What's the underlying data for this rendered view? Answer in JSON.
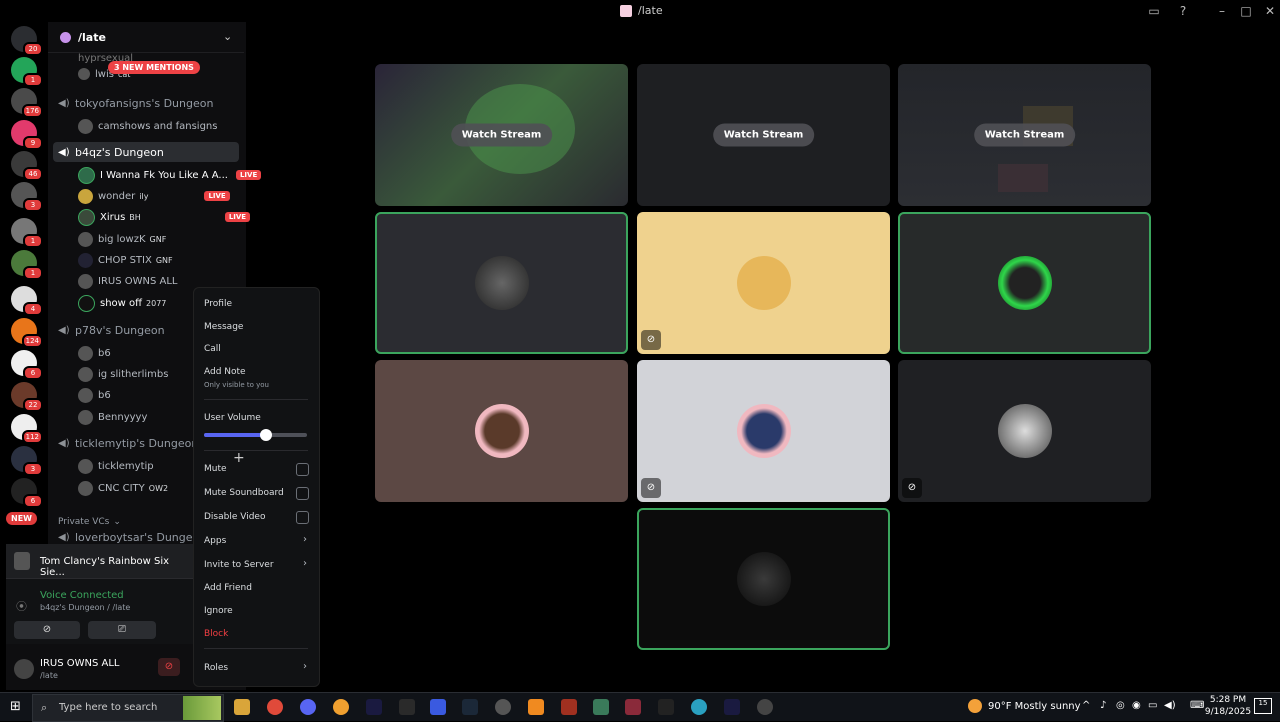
{
  "window": {
    "title": "/late"
  },
  "colors": {
    "live": "#ed4245",
    "speaking": "#3ba55d",
    "voice_connected": "#3ba55d",
    "block": "#f23f43"
  },
  "rail": {
    "badges": [
      "20",
      "1",
      "176",
      "9",
      "46",
      "3",
      "1",
      "1",
      "4",
      "124",
      "6",
      "22",
      "112",
      "3",
      "6",
      "8"
    ],
    "new_label": "NEW"
  },
  "channel": {
    "server_name": "/late",
    "new_mentions": "3 NEW MENTIONS",
    "voice_channels": [
      {
        "name": "tokyofansigns's Dungeon"
      },
      {
        "name": "b4qz's Dungeon"
      },
      {
        "name": "p78v's Dungeon"
      },
      {
        "name": "ticklemytip's Dungeon"
      },
      {
        "name": "loverboytsar's Dungeon"
      }
    ],
    "top_users": [
      "hyprsexual",
      "lwis",
      "cat"
    ],
    "tokyo_users": [
      "camshows and fansigns"
    ],
    "b4qz_users": [
      {
        "name": "I Wanna Fk You Like A A...",
        "live": "LIVE"
      },
      {
        "name": "wonder",
        "tag": "ily",
        "live": "LIVE"
      },
      {
        "name": "Xirus",
        "tag": "BH",
        "live": "LIVE"
      },
      {
        "name": "big lowzK",
        "tag": "GNF"
      },
      {
        "name": "CHOP STIX",
        "tag": "GNF"
      },
      {
        "name": "IRUS OWNS ALL"
      },
      {
        "name": "show off",
        "tag": "2077"
      }
    ],
    "p78v_users": [
      "b6",
      "ig slitherlimbs",
      "b6",
      "Bennyyyy"
    ],
    "tickle_users": [
      {
        "name": "ticklemytip"
      },
      {
        "name": "CNC CITY",
        "tag": "OW2"
      }
    ],
    "private_label": "Private VCs"
  },
  "panel": {
    "activity": "Tom Clancy's Rainbow Six Sie...",
    "voice_status": "Voice Connected",
    "voice_location": "b4qz's Dungeon / /late",
    "username": "IRUS OWNS ALL",
    "user_status": "/late"
  },
  "context_menu": {
    "profile": "Profile",
    "message": "Message",
    "call": "Call",
    "add_note": "Add Note",
    "add_note_sub": "Only visible to you",
    "user_volume": "User Volume",
    "volume_level": 0.6,
    "mute": "Mute",
    "mute_soundboard": "Mute Soundboard",
    "disable_video": "Disable Video",
    "apps": "Apps",
    "invite": "Invite to Server",
    "add_friend": "Add Friend",
    "ignore": "Ignore",
    "block": "Block",
    "roles": "Roles"
  },
  "grid": {
    "watch_label": "Watch Stream"
  },
  "taskbar": {
    "search_placeholder": "Type here to search",
    "weather": "90°F  Mostly sunny",
    "time": "5:28 PM",
    "date": "9/18/2025",
    "notif_count": "15"
  }
}
